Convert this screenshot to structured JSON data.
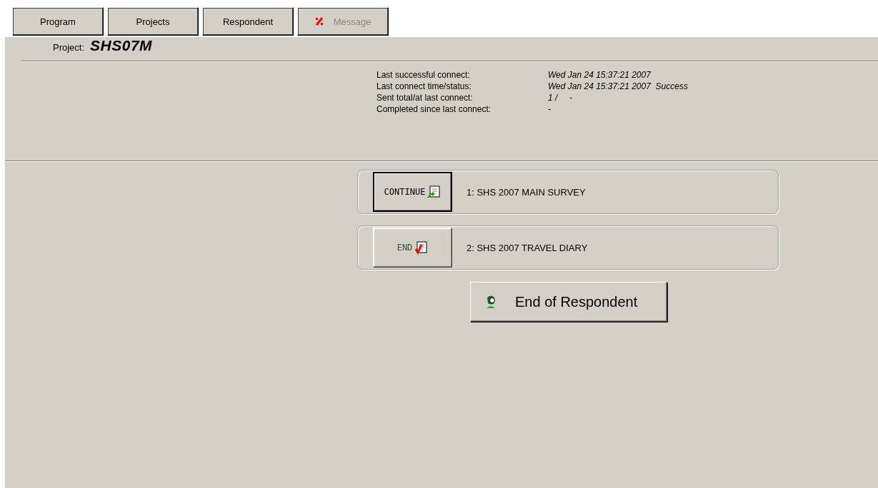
{
  "toolbar": [
    {
      "label": "Program",
      "disabled": false,
      "icon": false
    },
    {
      "label": "Projects",
      "disabled": false,
      "icon": false
    },
    {
      "label": "Respondent",
      "disabled": false,
      "icon": false
    },
    {
      "label": "Message",
      "disabled": true,
      "icon": true
    }
  ],
  "project": {
    "label": "Project:",
    "value": "SHS07M"
  },
  "status": [
    {
      "label": "Last successful connect:",
      "value": "Wed Jan 24 15:37:21 2007"
    },
    {
      "label": "Last connect time/status:",
      "value": "Wed Jan 24 15:37:21 2007  Success"
    },
    {
      "label": "Sent total/at last connect:",
      "value": "1 /     -"
    },
    {
      "label": "Completed since last connect:",
      "value": "-"
    }
  ],
  "surveys": [
    {
      "kind": "continue",
      "button": "CONTINUE",
      "default": true,
      "title": "1: SHS 2007 MAIN SURVEY"
    },
    {
      "kind": "end",
      "button": "END",
      "default": false,
      "title": "2: SHS 2007 TRAVEL DIARY"
    }
  ],
  "end_button": {
    "label": "End of Respondent"
  }
}
